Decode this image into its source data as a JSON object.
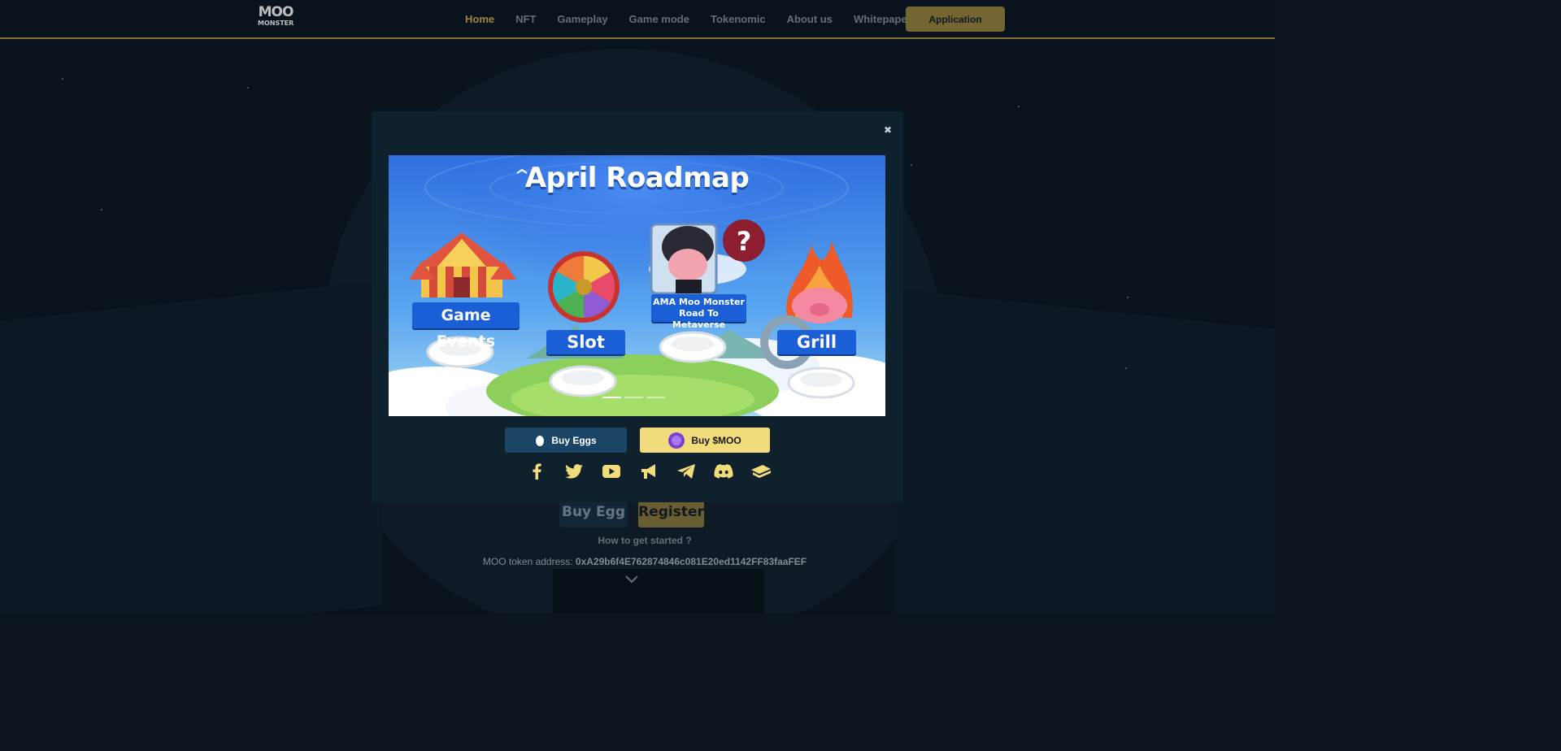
{
  "header": {
    "logo_top": "MOO",
    "logo_bottom": "MONSTER",
    "nav": [
      {
        "label": "Home",
        "active": true
      },
      {
        "label": "NFT"
      },
      {
        "label": "Gameplay"
      },
      {
        "label": "Game mode"
      },
      {
        "label": "Tokenomic"
      },
      {
        "label": "About us"
      },
      {
        "label": "Whitepaper"
      }
    ],
    "application_label": "Application"
  },
  "hero": {
    "buy_egg_label": "Buy Egg",
    "register_label": "Register",
    "how_to_label": "How to get started ?",
    "token_prefix": "MOO token address: ",
    "token_address": "0xA29b6f4E762874846c081E20ed1142FF83faaFEF"
  },
  "modal": {
    "banner": {
      "title": "April Roadmap",
      "items": [
        {
          "label": "Game Events"
        },
        {
          "label": "Slot"
        },
        {
          "label_line1": "AMA Moo Monster",
          "label_line2": "Road To Metaverse"
        },
        {
          "label": "Grill"
        }
      ],
      "slides": 3,
      "active_slide": 0
    },
    "buy_eggs_label": "Buy Eggs",
    "buy_moo_label": "Buy $MOO",
    "socials": [
      "facebook-icon",
      "twitter-icon",
      "youtube-icon",
      "megaphone-icon",
      "telegram-icon",
      "discord-icon",
      "book-icon"
    ]
  },
  "colors": {
    "accent": "#a68e3b",
    "modal_bg": "#10212e",
    "moo_button": "#f2db7a",
    "eggs_button": "#1a4566"
  }
}
